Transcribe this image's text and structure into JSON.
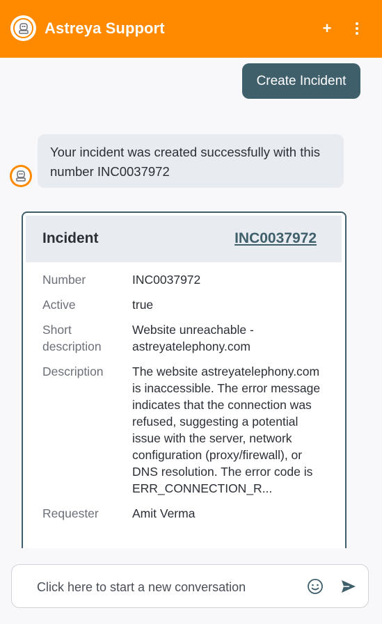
{
  "header": {
    "title": "Astreya Support",
    "new_label": "+",
    "brand_color": "#ff8a00"
  },
  "conversation": {
    "user_message": "Create Incident",
    "bot_message": "Your incident was created successfully with this number INC0037972"
  },
  "incident_card": {
    "heading": "Incident",
    "link_text": "INC0037972",
    "fields": [
      {
        "label": "Number",
        "value": "INC0037972"
      },
      {
        "label": "Active",
        "value": "true"
      },
      {
        "label": "Short description",
        "value": "Website unreachable - astreyatelephony.com"
      },
      {
        "label": "Description",
        "value": "The website astreyatelephony.com is inaccessible. The error message indicates that the connection was refused, suggesting a potential issue with the server, network configuration (proxy/firewall), or DNS resolution. The error code is ERR_CONNECTION_R..."
      },
      {
        "label": "Requester",
        "value": "Amit Verma"
      }
    ]
  },
  "composer": {
    "placeholder": "Click here to start a new conversation",
    "emoji_icon": "smiley-icon",
    "send_icon": "send-icon"
  }
}
